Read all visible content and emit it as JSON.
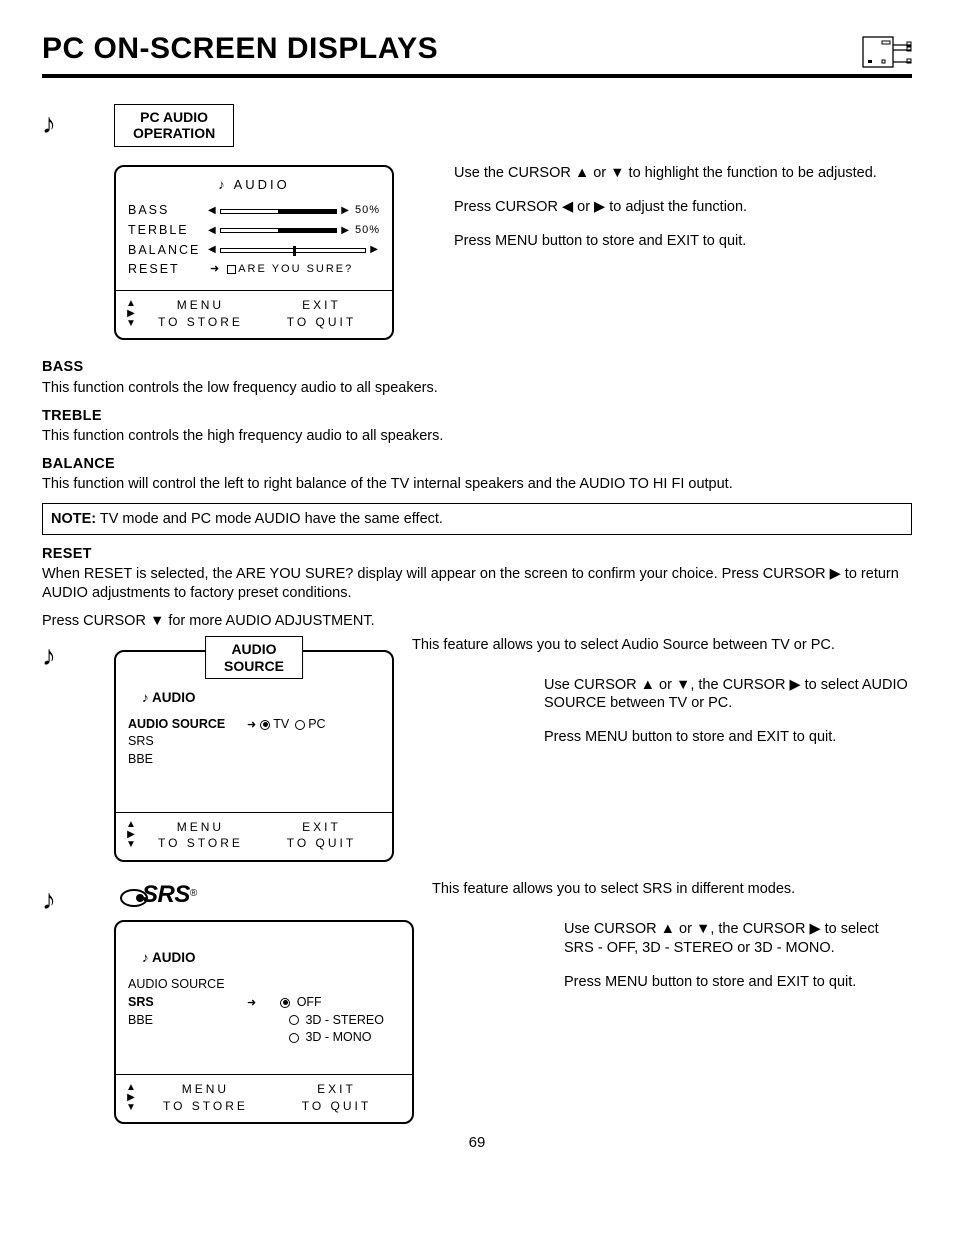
{
  "header": {
    "title": "PC ON-SCREEN DISPLAYS"
  },
  "pageNumber": "69",
  "osd1": {
    "label_l1": "PC AUDIO",
    "label_l2": "OPERATION",
    "head": "AUDIO",
    "rows": {
      "bass": "BASS",
      "treble": "TERBLE",
      "balance": "BALANCE",
      "reset": "RESET"
    },
    "bass_pct": "50%",
    "treble_pct": "50%",
    "reset_prompt": "ARE YOU SURE?",
    "menu": "MENU",
    "to_store": "TO STORE",
    "exit": "EXIT",
    "to_quit": "TO QUIT"
  },
  "right1": {
    "p1a": "Use the CURSOR ▲ or ▼ to highlight the function to be adjusted.",
    "p2": "Press CURSOR ◀ or ▶ to adjust the function.",
    "p3": "Press MENU button to store and EXIT to quit."
  },
  "sections": {
    "bass_h": "BASS",
    "bass_t": "This function controls the low frequency audio to all speakers.",
    "treble_h": "TREBLE",
    "treble_t": "This function controls the high frequency audio to all speakers.",
    "balance_h": "BALANCE",
    "balance_t": "This function will control the left to right balance of the TV internal speakers and the AUDIO TO HI FI output.",
    "note_label": "NOTE:",
    "note_t": " TV mode and PC mode AUDIO have the same effect.",
    "reset_h": "RESET",
    "reset_t": "When RESET is selected, the  ARE YOU SURE?  display will appear on the screen to confirm your choice. Press CURSOR ▶ to return AUDIO adjustments to factory preset conditions.",
    "more": "Press CURSOR ▼ for more AUDIO ADJUSTMENT."
  },
  "osd2": {
    "label_l1": "AUDIO",
    "label_l2": "SOURCE",
    "head": "AUDIO",
    "r1": "AUDIO SOURCE",
    "opt_tv": "TV",
    "opt_pc": "PC",
    "r2": "SRS",
    "r3": "BBE",
    "menu": "MENU",
    "to_store": "TO STORE",
    "exit": "EXIT",
    "to_quit": "TO QUIT"
  },
  "right2": {
    "intro": "This feature allows you to select Audio Source between TV or PC.",
    "p1": "Use CURSOR ▲ or ▼, the CURSOR ▶ to select AUDIO SOURCE between TV or PC.",
    "p2": "Press MENU button to store and EXIT to quit."
  },
  "osd3": {
    "logo": "SRS",
    "head": "AUDIO",
    "r1": "AUDIO SOURCE",
    "r2": "SRS",
    "r3": "BBE",
    "opt_off": "OFF",
    "opt_stereo": "3D - STEREO",
    "opt_mono": "3D - MONO",
    "menu": "MENU",
    "to_store": "TO STORE",
    "exit": "EXIT",
    "to_quit": "TO QUIT"
  },
  "right3": {
    "intro": "This feature allows you to select SRS in different modes.",
    "p1": "Use CURSOR ▲ or ▼, the CURSOR ▶ to select SRS - OFF, 3D - STEREO or 3D - MONO.",
    "p2": "Press MENU button to store and EXIT to quit."
  }
}
